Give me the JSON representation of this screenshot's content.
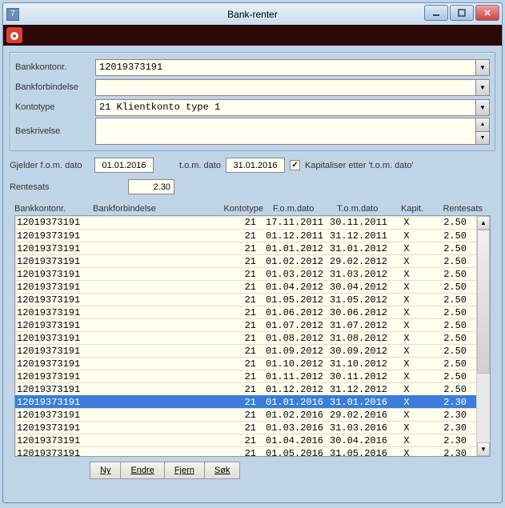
{
  "window": {
    "icon_text": "7",
    "title": "Bank-renter"
  },
  "form": {
    "bank_account_label": "Bankkontonr.",
    "bank_account_value": "12019373191",
    "bank_conn_label": "Bankforbindelse",
    "bank_conn_value": "",
    "account_type_label": "Kontotype",
    "account_type_value": "21 Klientkonto type 1",
    "description_label": "Beskrivelse",
    "description_value": ""
  },
  "filters": {
    "from_label": "Gjelder f.o.m. dato",
    "from_value": "01.01.2016",
    "to_label": "t.o.m. dato",
    "to_value": "31.01.2016",
    "cap_checked": "✓",
    "cap_label": "Kapitaliser etter 't.o.m. dato'",
    "rate_label": "Rentesats",
    "rate_value": "2.30"
  },
  "grid": {
    "headers": {
      "c1": "Bankkontonr.",
      "c2": "Bankforbindelse",
      "c3": "Kontotype",
      "c4": "F.o.m.dato",
      "c5": "T.o.m.dato",
      "c6": "Kapit.",
      "c7": "Rentesats"
    },
    "rows": [
      {
        "acc": "12019373191",
        "type": "21",
        "from": "17.11.2011",
        "to": "30.11.2011",
        "kap": "X",
        "rate": "2.50",
        "sel": false
      },
      {
        "acc": "12019373191",
        "type": "21",
        "from": "01.12.2011",
        "to": "31.12.2011",
        "kap": "X",
        "rate": "2.50",
        "sel": false
      },
      {
        "acc": "12019373191",
        "type": "21",
        "from": "01.01.2012",
        "to": "31.01.2012",
        "kap": "X",
        "rate": "2.50",
        "sel": false
      },
      {
        "acc": "12019373191",
        "type": "21",
        "from": "01.02.2012",
        "to": "29.02.2012",
        "kap": "X",
        "rate": "2.50",
        "sel": false
      },
      {
        "acc": "12019373191",
        "type": "21",
        "from": "01.03.2012",
        "to": "31.03.2012",
        "kap": "X",
        "rate": "2.50",
        "sel": false
      },
      {
        "acc": "12019373191",
        "type": "21",
        "from": "01.04.2012",
        "to": "30.04.2012",
        "kap": "X",
        "rate": "2.50",
        "sel": false
      },
      {
        "acc": "12019373191",
        "type": "21",
        "from": "01.05.2012",
        "to": "31.05.2012",
        "kap": "X",
        "rate": "2.50",
        "sel": false
      },
      {
        "acc": "12019373191",
        "type": "21",
        "from": "01.06.2012",
        "to": "30.06.2012",
        "kap": "X",
        "rate": "2.50",
        "sel": false
      },
      {
        "acc": "12019373191",
        "type": "21",
        "from": "01.07.2012",
        "to": "31.07.2012",
        "kap": "X",
        "rate": "2.50",
        "sel": false
      },
      {
        "acc": "12019373191",
        "type": "21",
        "from": "01.08.2012",
        "to": "31.08.2012",
        "kap": "X",
        "rate": "2.50",
        "sel": false
      },
      {
        "acc": "12019373191",
        "type": "21",
        "from": "01.09.2012",
        "to": "30.09.2012",
        "kap": "X",
        "rate": "2.50",
        "sel": false
      },
      {
        "acc": "12019373191",
        "type": "21",
        "from": "01.10.2012",
        "to": "31.10.2012",
        "kap": "X",
        "rate": "2.50",
        "sel": false
      },
      {
        "acc": "12019373191",
        "type": "21",
        "from": "01.11.2012",
        "to": "30.11.2012",
        "kap": "X",
        "rate": "2.50",
        "sel": false
      },
      {
        "acc": "12019373191",
        "type": "21",
        "from": "01.12.2012",
        "to": "31.12.2012",
        "kap": "X",
        "rate": "2.50",
        "sel": false
      },
      {
        "acc": "12019373191",
        "type": "21",
        "from": "01.01.2016",
        "to": "31.01.2016",
        "kap": "X",
        "rate": "2.30",
        "sel": true
      },
      {
        "acc": "12019373191",
        "type": "21",
        "from": "01.02.2016",
        "to": "29.02.2016",
        "kap": "X",
        "rate": "2.30",
        "sel": false
      },
      {
        "acc": "12019373191",
        "type": "21",
        "from": "01.03.2016",
        "to": "31.03.2016",
        "kap": "X",
        "rate": "2.30",
        "sel": false
      },
      {
        "acc": "12019373191",
        "type": "21",
        "from": "01.04.2016",
        "to": "30.04.2016",
        "kap": "X",
        "rate": "2.30",
        "sel": false
      },
      {
        "acc": "12019373191",
        "type": "21",
        "from": "01.05.2016",
        "to": "31.05.2016",
        "kap": "X",
        "rate": "2.30",
        "sel": false
      }
    ]
  },
  "buttons": {
    "new": "Ny",
    "edit": "Endre",
    "remove": "Fjern",
    "search": "Søk"
  }
}
